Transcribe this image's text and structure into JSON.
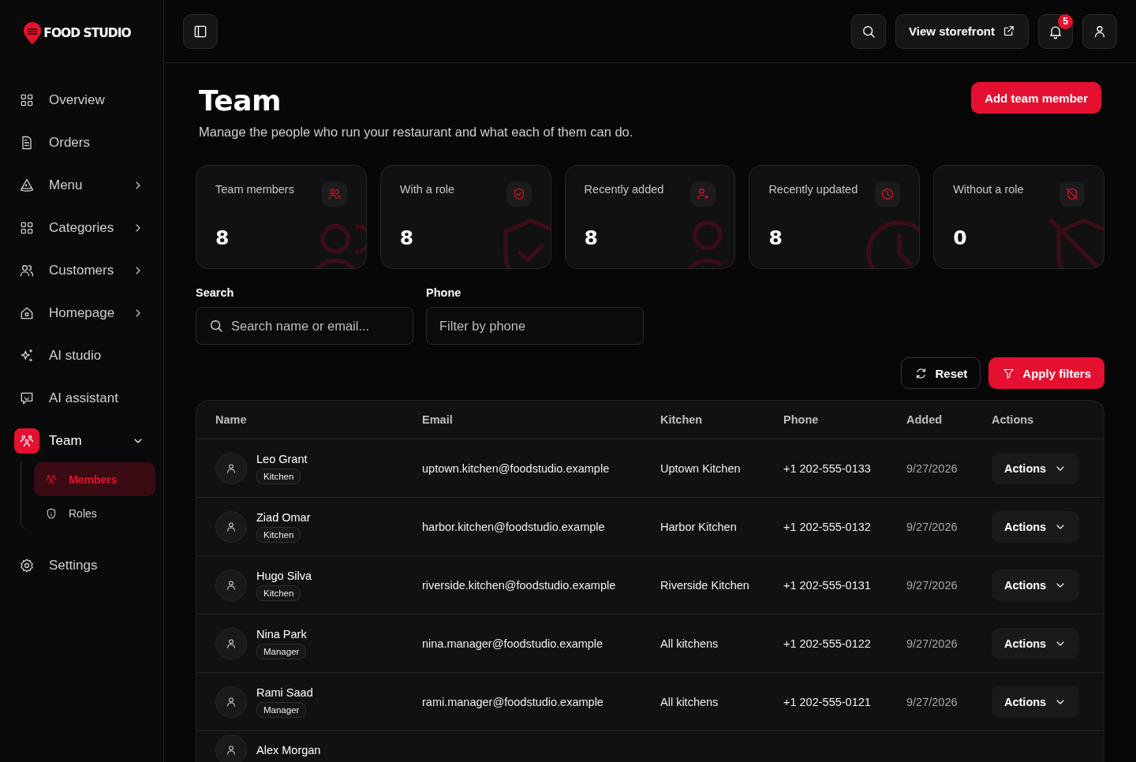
{
  "brand": {
    "name": "FOOD STUDIO"
  },
  "sidebar": {
    "items": [
      {
        "label": "Overview",
        "kind": "link",
        "selected": false
      },
      {
        "label": "Orders",
        "kind": "link",
        "selected": false
      },
      {
        "label": "Menu",
        "kind": "group",
        "selected": false,
        "expanded": false
      },
      {
        "label": "Categories",
        "kind": "group",
        "selected": false,
        "expanded": false
      },
      {
        "label": "Customers",
        "kind": "group",
        "selected": false,
        "expanded": false
      },
      {
        "label": "Homepage",
        "kind": "group",
        "selected": false,
        "expanded": false
      },
      {
        "label": "AI studio",
        "kind": "link",
        "selected": false
      },
      {
        "label": "AI assistant",
        "kind": "link",
        "selected": false
      },
      {
        "label": "Team",
        "kind": "group",
        "selected": true,
        "expanded": true,
        "children": [
          {
            "label": "Members",
            "selected": true
          },
          {
            "label": "Roles",
            "selected": false
          }
        ]
      },
      {
        "label": "Settings",
        "kind": "link",
        "selected": false
      }
    ]
  },
  "topbar": {
    "storefront_button": "View storefront",
    "notifications_badge": "5"
  },
  "header": {
    "title": "Team",
    "subtitle": "Manage the people who run your restaurant and what each of them can do.",
    "add_button": "Add team member"
  },
  "stats": [
    {
      "label": "Team members",
      "value": "8"
    },
    {
      "label": "With a role",
      "value": "8"
    },
    {
      "label": "Recently added",
      "value": "8"
    },
    {
      "label": "Recently updated",
      "value": "8"
    },
    {
      "label": "Without a role",
      "value": "0"
    }
  ],
  "filters": {
    "search": {
      "label": "Search",
      "placeholder": "Search name or email..."
    },
    "phone": {
      "label": "Phone",
      "placeholder": "Filter by phone"
    },
    "reset_button": "Reset",
    "apply_button": "Apply filters"
  },
  "table": {
    "columns": [
      "Name",
      "Email",
      "Kitchen",
      "Phone",
      "Added",
      "Actions"
    ],
    "rows": [
      {
        "name": "Leo Grant",
        "role": "Kitchen",
        "email": "uptown.kitchen@foodstudio.example",
        "kitchen": "Uptown Kitchen",
        "phone": "+1 202-555-0133",
        "added": "9/27/2026",
        "action": "Actions"
      },
      {
        "name": "Ziad Omar",
        "role": "Kitchen",
        "email": "harbor.kitchen@foodstudio.example",
        "kitchen": "Harbor Kitchen",
        "phone": "+1 202-555-0132",
        "added": "9/27/2026",
        "action": "Actions"
      },
      {
        "name": "Hugo Silva",
        "role": "Kitchen",
        "email": "riverside.kitchen@foodstudio.example",
        "kitchen": "Riverside Kitchen",
        "phone": "+1 202-555-0131",
        "added": "9/27/2026",
        "action": "Actions"
      },
      {
        "name": "Nina Park",
        "role": "Manager",
        "email": "nina.manager@foodstudio.example",
        "kitchen": "All kitchens",
        "phone": "+1 202-555-0122",
        "added": "9/27/2026",
        "action": "Actions"
      },
      {
        "name": "Rami Saad",
        "role": "Manager",
        "email": "rami.manager@foodstudio.example",
        "kitchen": "All kitchens",
        "phone": "+1 202-555-0121",
        "added": "9/27/2026",
        "action": "Actions"
      },
      {
        "name": "Alex Morgan"
      }
    ]
  }
}
